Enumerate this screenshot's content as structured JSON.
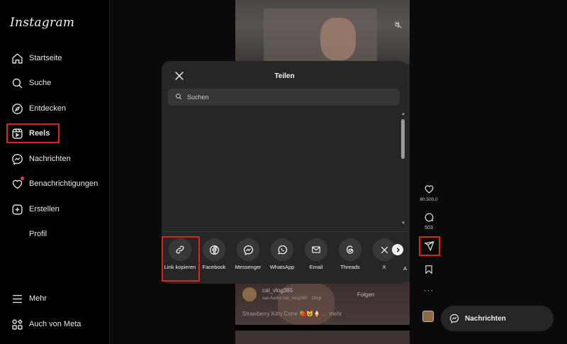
{
  "app": {
    "logo_text": "Instagram"
  },
  "sidebar": {
    "items": [
      {
        "label": "Startseite",
        "icon": "home-icon"
      },
      {
        "label": "Suche",
        "icon": "search-icon"
      },
      {
        "label": "Entdecken",
        "icon": "compass-icon"
      },
      {
        "label": "Reels",
        "icon": "reels-icon",
        "active": true
      },
      {
        "label": "Nachrichten",
        "icon": "messenger-icon"
      },
      {
        "label": "Benachrichtigungen",
        "icon": "heart-icon"
      },
      {
        "label": "Erstellen",
        "icon": "plus-square-icon"
      },
      {
        "label": "Profil",
        "icon": "avatar"
      }
    ],
    "bottom": [
      {
        "label": "Mehr",
        "icon": "menu-icon"
      },
      {
        "label": "Auch von Meta",
        "icon": "meta-grid-icon"
      }
    ]
  },
  "reel": {
    "username": "cat_vlog365",
    "audio": "sal-Audio      cat_vlog365 · Origi",
    "follow": "Folgen",
    "caption": "Strawberry Kitty Cone 🍓😺🍦 … mehr"
  },
  "actions": {
    "likes": "80.500,0",
    "comments": "503"
  },
  "messages_pill": {
    "label": "Nachrichten"
  },
  "share_modal": {
    "title": "Teilen",
    "search_placeholder": "Suchen",
    "targets": [
      {
        "label": "Link kopieren",
        "icon": "link-icon"
      },
      {
        "label": "Facebook",
        "icon": "facebook-icon"
      },
      {
        "label": "Messenger",
        "icon": "messenger-icon"
      },
      {
        "label": "WhatsApp",
        "icon": "whatsapp-icon"
      },
      {
        "label": "Email",
        "icon": "email-icon"
      },
      {
        "label": "Threads",
        "icon": "threads-icon"
      },
      {
        "label": "X",
        "icon": "x-icon"
      }
    ],
    "cut_label": "A"
  },
  "colors": {
    "highlight": "#e0201e",
    "background": "#000000",
    "modal": "#262626"
  }
}
